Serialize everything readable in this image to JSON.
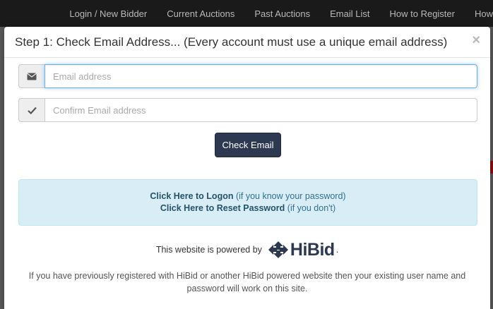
{
  "nav": {
    "items": [
      "Login / New Bidder",
      "Current Auctions",
      "Past Auctions",
      "Email List",
      "How to Register",
      "How"
    ]
  },
  "modal": {
    "title": "Step 1: Check Email Address... (Every account must use a unique email address)",
    "close_glyph": "×"
  },
  "form": {
    "email_icon": "envelope-icon",
    "email_placeholder": "Email address",
    "email_value": "",
    "confirm_icon": "checkmark-icon",
    "confirm_placeholder": "Confirm Email address",
    "confirm_value": "",
    "submit_label": "Check Email"
  },
  "info": {
    "logon_link": "Click Here to Logon",
    "logon_hint": "(if you know your password)",
    "reset_link": "Click Here to Reset Password",
    "reset_hint": "(if you don't)"
  },
  "powered": {
    "text": "This website is powered by",
    "logo_text": "HiBid",
    "suffix": "."
  },
  "footer": {
    "note": "If you have previously registered with HiBid or another HiBid powered website then your existing user name and password will work on this site."
  },
  "colors": {
    "primary_button": "#2d3851",
    "info_background": "#d9edf7",
    "info_text": "#31708f",
    "focus_border": "#66afe9"
  }
}
